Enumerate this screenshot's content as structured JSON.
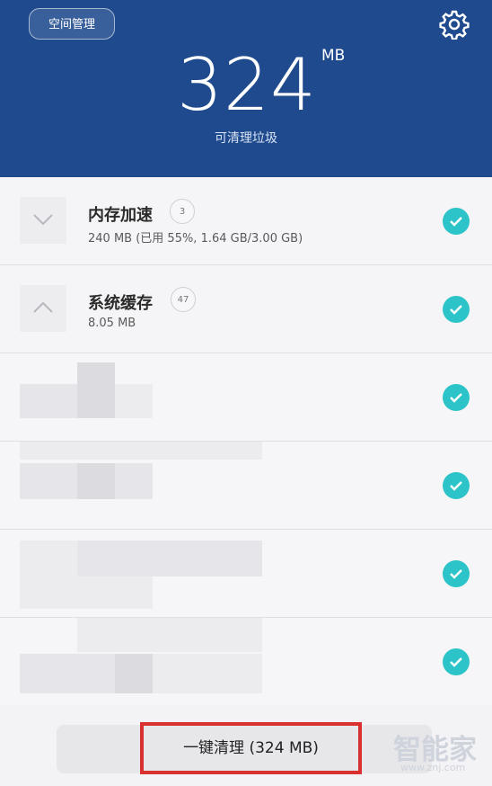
{
  "header": {
    "space_button": "空间管理",
    "settings_icon": "gear-icon",
    "size_value": "324",
    "size_unit": "MB",
    "subtitle": "可清理垃圾",
    "color": "#1f4b8e"
  },
  "items": [
    {
      "title": "内存加速",
      "badge": "3",
      "detail": "240 MB (已用 55%, 1.64 GB/3.00 GB)",
      "chevron": "chevron-down-icon",
      "checked": true
    },
    {
      "title": "系统缓存",
      "badge": "47",
      "detail": "8.05 MB",
      "chevron": "chevron-up-icon",
      "checked": true
    }
  ],
  "blurred_rows_count": 4,
  "clean_button": "一键清理 (324 MB)",
  "watermark": {
    "text": "智能家",
    "url": "www.znj.com"
  },
  "accent_color": "#2cc4c8"
}
